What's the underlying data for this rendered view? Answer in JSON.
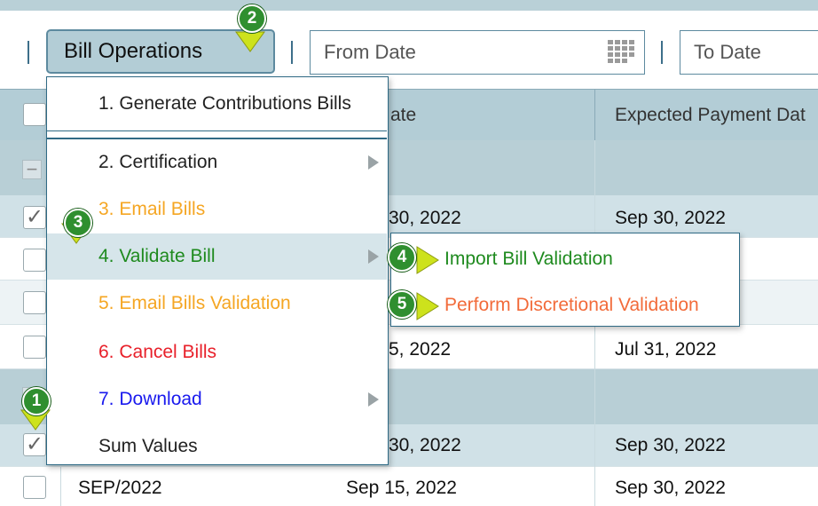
{
  "toolbar": {
    "bill_operations_label": "Bill Operations",
    "from_date_placeholder": "From Date",
    "to_date_placeholder": "To Date"
  },
  "table": {
    "headers": [
      "ate",
      "Expected Payment Dat"
    ],
    "rows": [
      {
        "c1": "30, 2022",
        "c2": "Sep 30, 2022",
        "checked": true
      },
      {
        "c1": "",
        "c2": "",
        "checked": false
      },
      {
        "c1": "",
        "c2": "",
        "checked": false
      },
      {
        "c1": "5, 2022",
        "c2": "Jul 31, 2022",
        "checked": false
      },
      {
        "c1": "30, 2022",
        "c2": "Sep 30, 2022",
        "checked": true
      },
      {
        "c0": "SEP/2022",
        "c1": "Sep 15, 2022",
        "c2": "Sep 30, 2022",
        "checked": false
      }
    ]
  },
  "menu": {
    "items": [
      {
        "label": "1. Generate Contributions Bills",
        "color": "#222222"
      },
      {
        "label": "2. Certification",
        "color": "#222222"
      },
      {
        "label": "3. Email Bills",
        "color": "#f5a623"
      },
      {
        "label": "4. Validate Bill",
        "color": "#1e8a1e"
      },
      {
        "label": "5. Email Bills Validation",
        "color": "#f5a623"
      },
      {
        "label": "6. Cancel Bills",
        "color": "#e8202a"
      },
      {
        "label": "7. Download",
        "color": "#1a1aee"
      },
      {
        "label": "Sum Values",
        "color": "#222222"
      }
    ]
  },
  "submenu": {
    "items": [
      {
        "label": "Import Bill Validation",
        "color": "#1e8a1e"
      },
      {
        "label": "Perform Discretional Validation",
        "color": "#f26b3a"
      }
    ]
  },
  "callouts": [
    "1",
    "2",
    "3",
    "4",
    "5"
  ],
  "icons": {
    "calendar": "calendar-icon",
    "submenu_arrow": "chevron-right-icon",
    "pointer": "arrow-pointer-icon"
  }
}
